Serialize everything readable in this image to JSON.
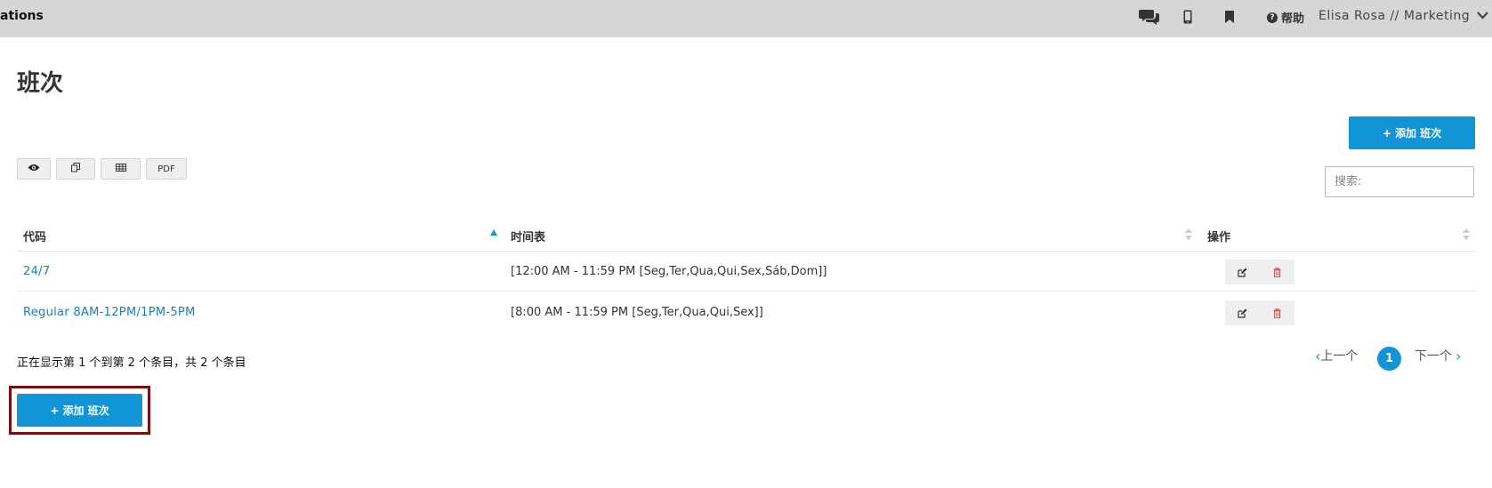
{
  "topbar": {
    "app_name": "ations",
    "icons": [
      "chat-icon",
      "mobile-icon",
      "bookmark-icon"
    ],
    "help_label": "帮助",
    "user_label": "Elisa Rosa // Marketing"
  },
  "page": {
    "title": "班次"
  },
  "buttons": {
    "add_label": "添加 班次",
    "add_icon": "+"
  },
  "toolbar": {
    "view_icon": "eye-icon",
    "copy_icon": "copy-icon",
    "table_icon": "table-icon",
    "pdf_label": "PDF"
  },
  "search": {
    "placeholder": "搜索:"
  },
  "table": {
    "columns": [
      "代码",
      "时间表",
      "操作"
    ],
    "rows": [
      {
        "code": "24/7",
        "schedule": "[12:00 AM - 11:59 PM [Seg,Ter,Qua,Qui,Sex,Sáb,Dom]]"
      },
      {
        "code": "Regular 8AM-12PM/1PM-5PM",
        "schedule": "[8:00 AM - 11:59 PM [Seg,Ter,Qua,Qui,Sex]]"
      }
    ]
  },
  "info": {
    "text": "正在显示第 1 个到第 2 个条目，共 2 个条目"
  },
  "pagination": {
    "prev_label": "上一个",
    "next_label": "下一个",
    "current_page": "1"
  },
  "colors": {
    "accent": "#1195d6",
    "link": "#1a7fc1",
    "topbar": "#d6d6d6",
    "highlight": "#7a0f10",
    "delete": "#d9534f"
  }
}
